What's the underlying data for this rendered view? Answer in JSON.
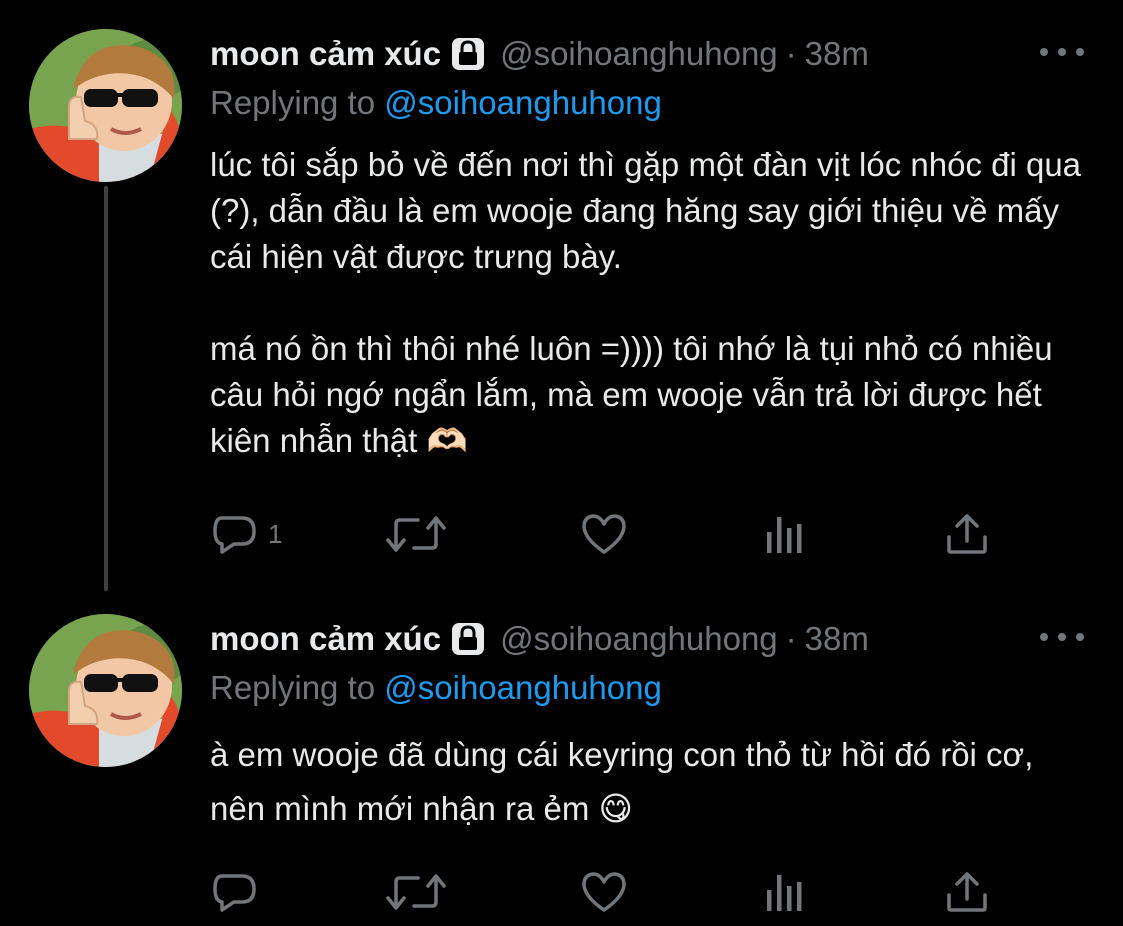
{
  "tweets": [
    {
      "display_name": "moon cảm xúc",
      "handle": "@soihoanghuhong",
      "separator": "·",
      "time": "38m",
      "replying_prefix": "Replying to ",
      "replying_handle": "@soihoanghuhong",
      "paragraph_1": "lúc tôi sắp bỏ về đến nơi thì gặp một đàn vịt lóc nhóc đi qua (?), dẫn đầu là em wooje đang hăng say giới thiệu về mấy cái hiện vật được trưng bày.",
      "paragraph_2": "má nó ồn thì thôi nhé luôn =)))) tôi nhớ là tụi nhỏ có nhiều câu hỏi ngớ ngẩn lắm, mà em wooje vẫn trả lời được hết kiên nhẫn thật 🫶🏻",
      "reply_count": "1",
      "icons": [
        "reply-icon",
        "retweet-icon",
        "like-icon",
        "analytics-icon",
        "share-icon"
      ]
    },
    {
      "display_name": "moon cảm xúc",
      "handle": "@soihoanghuhong",
      "separator": "·",
      "time": "38m",
      "replying_prefix": "Replying to ",
      "replying_handle": "@soihoanghuhong",
      "paragraph_1": "à em wooje đã dùng cái keyring con thỏ từ hồi đó rồi cơ, nên mình mới nhận ra ẻm 😋",
      "reply_count": "",
      "icons": [
        "reply-icon",
        "retweet-icon",
        "like-icon",
        "analytics-icon",
        "share-icon"
      ]
    }
  ],
  "colors": {
    "background": "#000000",
    "text": "#e7e9ea",
    "secondary": "#71767b",
    "mention": "#1d9bf0",
    "thread_line": "#3e4144"
  }
}
